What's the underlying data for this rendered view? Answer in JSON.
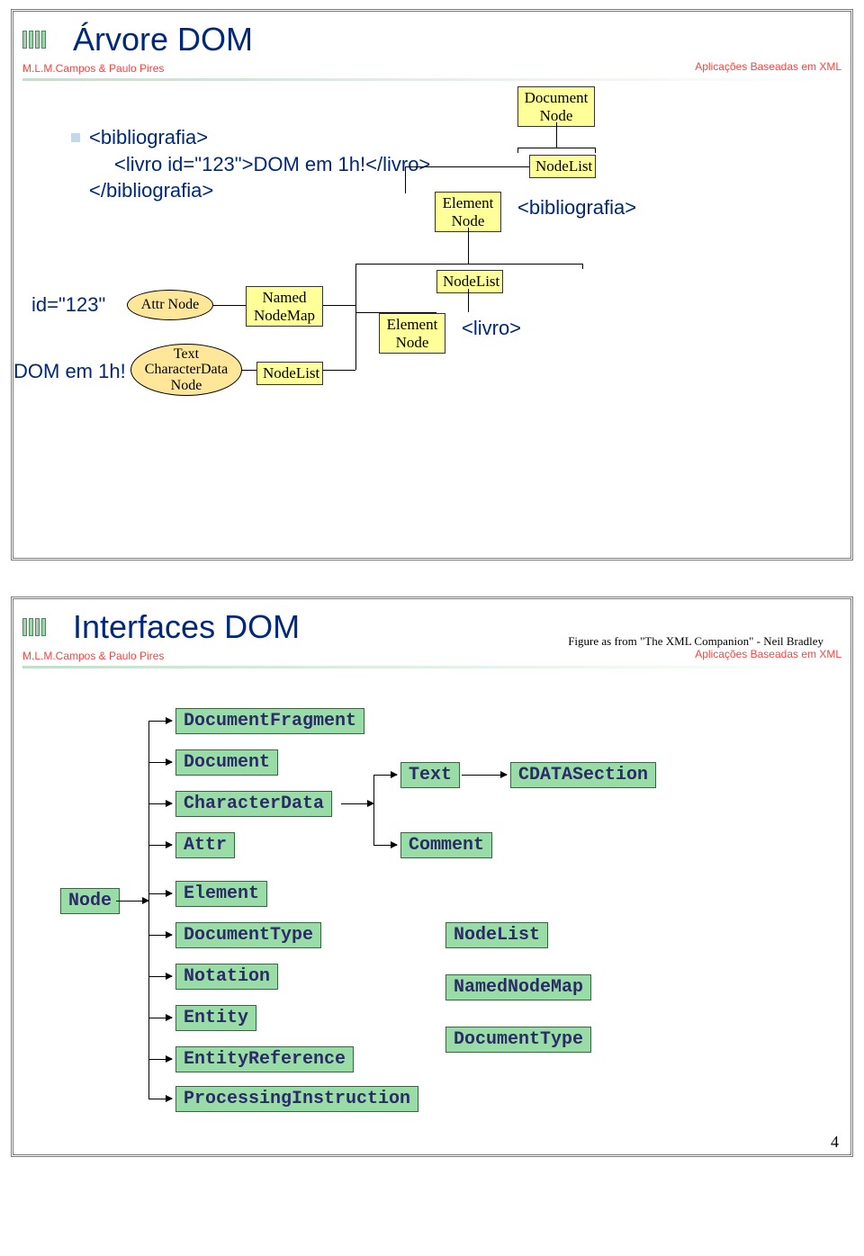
{
  "slide1": {
    "title": "Árvore DOM",
    "author": "M.L.M.Campos & Paulo Pires",
    "course": "Aplicações Baseadas em XML",
    "code": {
      "l1": "<bibliografia>",
      "l2": "<livro id=\"123\">DOM em 1h!</livro>",
      "l3": "</bibliografia>"
    },
    "boxes": {
      "doc": "Document\nNode",
      "nl1": "NodeList",
      "elBib": "Element\nNode",
      "labelBib": "<bibliografia>",
      "idLabel": "id=\"123\"",
      "attr": "Attr Node",
      "nnm": "Named\nNodeMap",
      "nl2": "NodeList",
      "elLivro": "Element\nNode",
      "labelLivro": "<livro>",
      "domLabel": "DOM em 1h!",
      "textNode": "Text\nCharacterData\nNode",
      "nl3": "NodeList"
    }
  },
  "slide2": {
    "title": "Interfaces DOM",
    "author": "M.L.M.Campos & Paulo Pires",
    "course": "Aplicações Baseadas em XML",
    "figAttr": "Figure as from \"The XML Companion\" - Neil Bradley",
    "boxes": {
      "node": "Node",
      "docFrag": "DocumentFragment",
      "document": "Document",
      "charData": "CharacterData",
      "attr": "Attr",
      "element": "Element",
      "docType1": "DocumentType",
      "notation": "Notation",
      "entity": "Entity",
      "entityRef": "EntityReference",
      "procInstr": "ProcessingInstruction",
      "text": "Text",
      "comment": "Comment",
      "cdata": "CDATASection",
      "nodeList": "NodeList",
      "namedNodeMap": "NamedNodeMap",
      "docType2": "DocumentType"
    }
  },
  "pageNum": "4"
}
